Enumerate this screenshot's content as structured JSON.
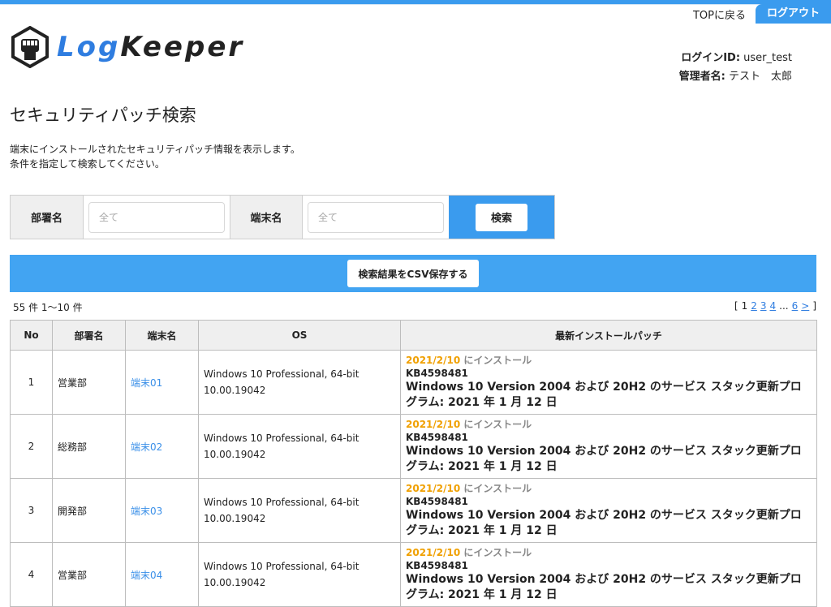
{
  "header": {
    "top_link": "TOPに戻る",
    "logout": "ログアウト",
    "logo_text_a": "Log",
    "logo_text_b": "Keeper"
  },
  "user": {
    "login_label": "ログインID:",
    "login_value": "user_test",
    "admin_label": "管理者名:",
    "admin_value": "テスト　太郎"
  },
  "page": {
    "title": "セキュリティパッチ検索",
    "desc_line1": "端末にインストールされたセキュリティパッチ情報を表示します。",
    "desc_line2": "条件を指定して検索してください。"
  },
  "search": {
    "dept_label": "部署名",
    "dept_placeholder": "全て",
    "term_label": "端末名",
    "term_placeholder": "全て",
    "search_button": "検索",
    "csv_button": "検索結果をCSV保存する"
  },
  "results": {
    "count_text": "55 件 1〜10 件",
    "pager": {
      "open": "[",
      "current": "1",
      "pages": [
        "2",
        "3",
        "4"
      ],
      "ellipsis": "...",
      "last": "6",
      "next": ">",
      "close": "]"
    },
    "columns": [
      "No",
      "部署名",
      "端末名",
      "OS",
      "最新インストールパッチ"
    ],
    "rows": [
      {
        "no": "1",
        "dept": "営業部",
        "terminal": "端末01",
        "os_name": "Windows 10 Professional, 64-bit",
        "os_ver": "10.00.19042",
        "patch_date": "2021/2/10",
        "patch_suffix": " にインストール",
        "kb": "KB4598481",
        "patch_title": "Windows 10 Version 2004 および 20H2 のサービス スタック更新プログラム: 2021 年 1 月 12 日"
      },
      {
        "no": "2",
        "dept": "総務部",
        "terminal": "端末02",
        "os_name": "Windows 10 Professional, 64-bit",
        "os_ver": "10.00.19042",
        "patch_date": "2021/2/10",
        "patch_suffix": " にインストール",
        "kb": "KB4598481",
        "patch_title": "Windows 10 Version 2004 および 20H2 のサービス スタック更新プログラム: 2021 年 1 月 12 日"
      },
      {
        "no": "3",
        "dept": "開発部",
        "terminal": "端末03",
        "os_name": "Windows 10 Professional, 64-bit",
        "os_ver": "10.00.19042",
        "patch_date": "2021/2/10",
        "patch_suffix": " にインストール",
        "kb": "KB4598481",
        "patch_title": "Windows 10 Version 2004 および 20H2 のサービス スタック更新プログラム: 2021 年 1 月 12 日"
      },
      {
        "no": "4",
        "dept": "営業部",
        "terminal": "端末04",
        "os_name": "Windows 10 Professional, 64-bit",
        "os_ver": "10.00.19042",
        "patch_date": "2021/2/10",
        "patch_suffix": " にインストール",
        "kb": "KB4598481",
        "patch_title": "Windows 10 Version 2004 および 20H2 のサービス スタック更新プログラム: 2021 年 1 月 12 日"
      }
    ]
  },
  "colors": {
    "accent": "#3a9bee",
    "link": "#2f7de0",
    "date": "#f0a000"
  },
  "icons": {
    "logo": "fist-hexagon-icon"
  }
}
